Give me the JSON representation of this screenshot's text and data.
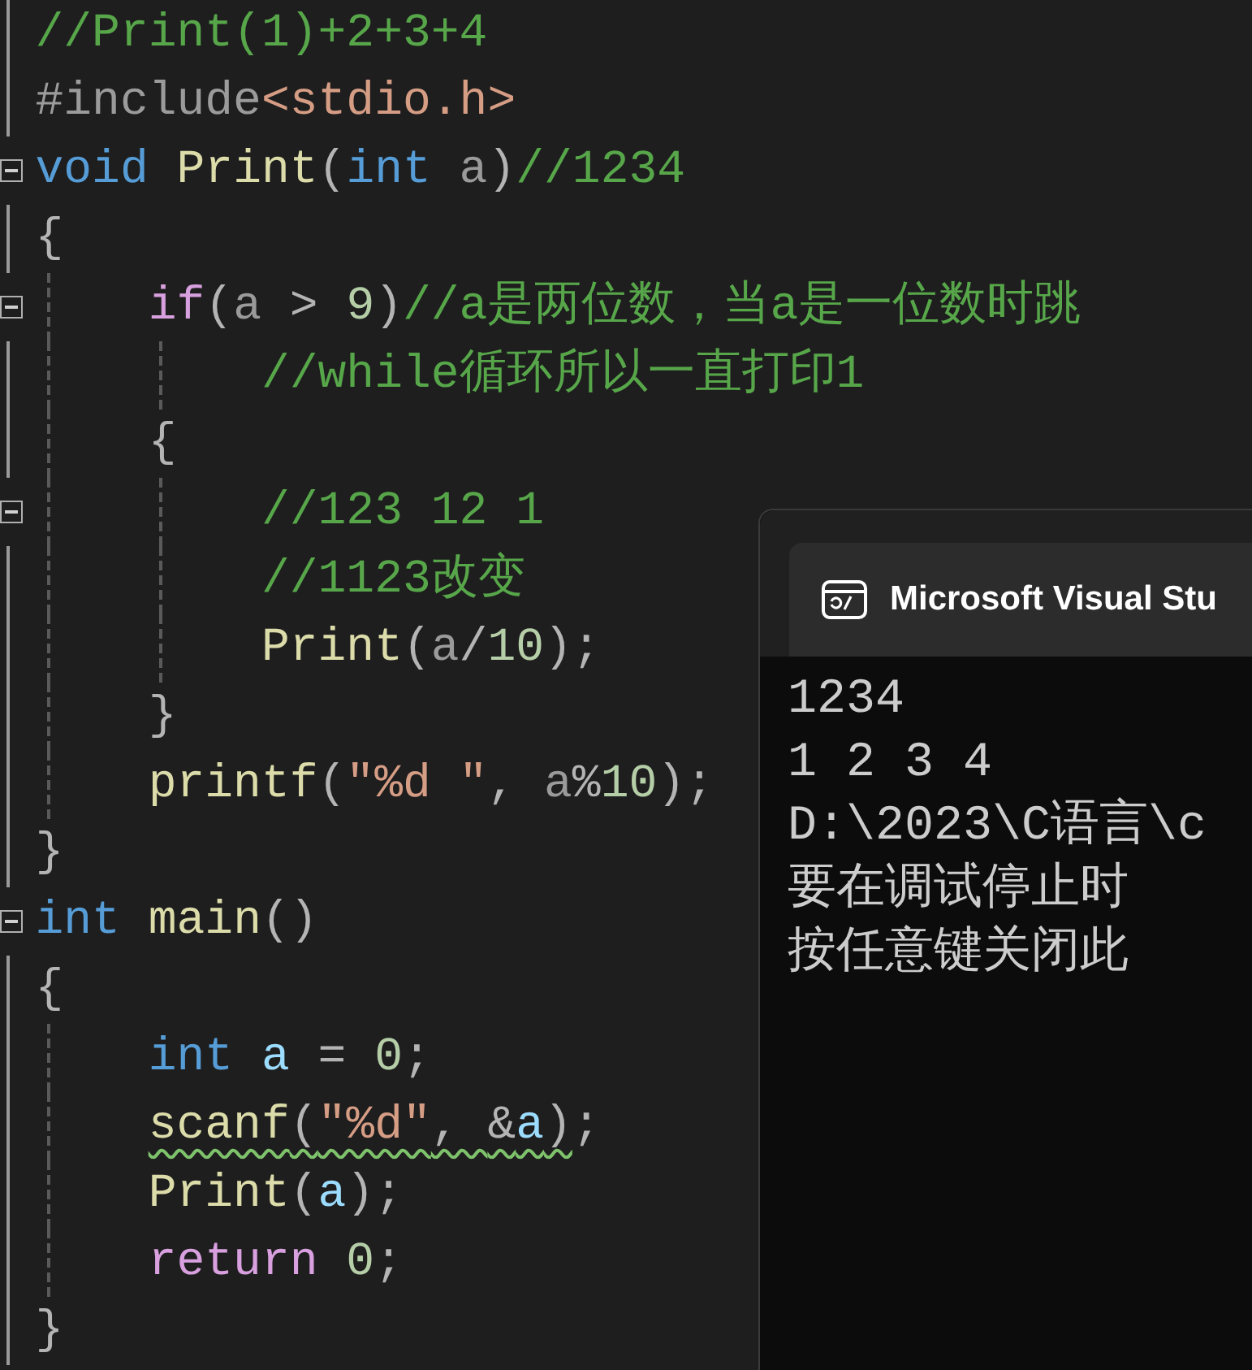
{
  "editor": {
    "lines": [
      {
        "fold": false,
        "tokens": [
          {
            "text": "//Print(1)+2+3+4",
            "kind": "comment"
          }
        ]
      },
      {
        "fold": false,
        "tokens": [
          {
            "text": "#include",
            "kind": "preproc"
          },
          {
            "text": "<stdio.h>",
            "kind": "string"
          }
        ]
      },
      {
        "fold": true,
        "tokens": [
          {
            "text": "void",
            "kind": "keyword"
          },
          {
            "text": " Print",
            "kind": "function"
          },
          {
            "text": "(",
            "kind": "punct"
          },
          {
            "text": "int",
            "kind": "keyword"
          },
          {
            "text": " a",
            "kind": "param"
          },
          {
            "text": ")",
            "kind": "punct"
          },
          {
            "text": "//1234",
            "kind": "comment"
          }
        ]
      },
      {
        "fold": false,
        "tokens": [
          {
            "text": "{",
            "kind": "brace"
          }
        ],
        "children": [
          {
            "fold": true,
            "tokens": [
              {
                "text": "if",
                "kind": "control"
              },
              {
                "text": "(",
                "kind": "punct"
              },
              {
                "text": "a",
                "kind": "param"
              },
              {
                "text": " > ",
                "kind": "punct"
              },
              {
                "text": "9",
                "kind": "number"
              },
              {
                "text": ")",
                "kind": "punct"
              },
              {
                "text": "//a是两位数，当a是一位数时跳",
                "kind": "comment"
              }
            ],
            "children": [
              {
                "fold": false,
                "tokens": [
                  {
                    "text": "//while循环所以一直打印1",
                    "kind": "comment"
                  }
                ]
              }
            ]
          },
          {
            "fold": false,
            "tokens": [
              {
                "text": "{",
                "kind": "brace"
              }
            ],
            "children": [
              {
                "fold": true,
                "tokens": [
                  {
                    "text": "//123 12 1",
                    "kind": "comment"
                  }
                ]
              },
              {
                "fold": false,
                "tokens": [
                  {
                    "text": "//1123改变",
                    "kind": "comment"
                  }
                ]
              },
              {
                "fold": false,
                "tokens": [
                  {
                    "text": "Print",
                    "kind": "function"
                  },
                  {
                    "text": "(",
                    "kind": "punct"
                  },
                  {
                    "text": "a",
                    "kind": "param"
                  },
                  {
                    "text": "/",
                    "kind": "punct"
                  },
                  {
                    "text": "10",
                    "kind": "number"
                  },
                  {
                    "text": ");",
                    "kind": "punct"
                  }
                ]
              }
            ]
          },
          {
            "fold": false,
            "tokens": [
              {
                "text": "}",
                "kind": "brace"
              }
            ]
          },
          {
            "fold": false,
            "tokens": [
              {
                "text": "printf",
                "kind": "function"
              },
              {
                "text": "(",
                "kind": "punct"
              },
              {
                "text": "\"%d \"",
                "kind": "string"
              },
              {
                "text": ", ",
                "kind": "punct"
              },
              {
                "text": "a",
                "kind": "param"
              },
              {
                "text": "%",
                "kind": "punct"
              },
              {
                "text": "10",
                "kind": "number"
              },
              {
                "text": ");",
                "kind": "punct"
              }
            ]
          }
        ]
      },
      {
        "fold": false,
        "tokens": [
          {
            "text": "}",
            "kind": "brace"
          }
        ]
      },
      {
        "fold": true,
        "tokens": [
          {
            "text": "int",
            "kind": "keyword"
          },
          {
            "text": " main",
            "kind": "function"
          },
          {
            "text": "()",
            "kind": "punct"
          }
        ]
      },
      {
        "fold": false,
        "tokens": [
          {
            "text": "{",
            "kind": "brace"
          }
        ],
        "children": [
          {
            "fold": false,
            "tokens": [
              {
                "text": "int",
                "kind": "keyword"
              },
              {
                "text": " a",
                "kind": "local"
              },
              {
                "text": " = ",
                "kind": "punct"
              },
              {
                "text": "0",
                "kind": "number"
              },
              {
                "text": ";",
                "kind": "punct"
              }
            ]
          },
          {
            "fold": false,
            "tokens": [
              {
                "text": "scanf",
                "kind": "function",
                "squiggle": true
              },
              {
                "text": "(",
                "kind": "punct",
                "squiggle": true
              },
              {
                "text": "\"%d\"",
                "kind": "string",
                "squiggle": true
              },
              {
                "text": ", ",
                "kind": "punct",
                "squiggle": true
              },
              {
                "text": "&",
                "kind": "punct",
                "squiggle": true
              },
              {
                "text": "a",
                "kind": "local",
                "squiggle": true
              },
              {
                "text": ")",
                "kind": "punct",
                "squiggle": true
              },
              {
                "text": ";",
                "kind": "punct"
              }
            ]
          },
          {
            "fold": false,
            "tokens": [
              {
                "text": "Print",
                "kind": "function"
              },
              {
                "text": "(",
                "kind": "punct"
              },
              {
                "text": "a",
                "kind": "local"
              },
              {
                "text": ");",
                "kind": "punct"
              }
            ]
          },
          {
            "fold": false,
            "tokens": [
              {
                "text": "return",
                "kind": "control"
              },
              {
                "text": " 0",
                "kind": "number"
              },
              {
                "text": ";",
                "kind": "punct"
              }
            ]
          }
        ]
      },
      {
        "fold": false,
        "tokens": [
          {
            "text": "}",
            "kind": "brace"
          }
        ]
      }
    ]
  },
  "console": {
    "title": "Microsoft Visual Stu",
    "lines": [
      "1234",
      "1 2 3 4",
      "D:\\2023\\C语言\\c",
      "要在调试停止时",
      "按任意键关闭此"
    ]
  }
}
